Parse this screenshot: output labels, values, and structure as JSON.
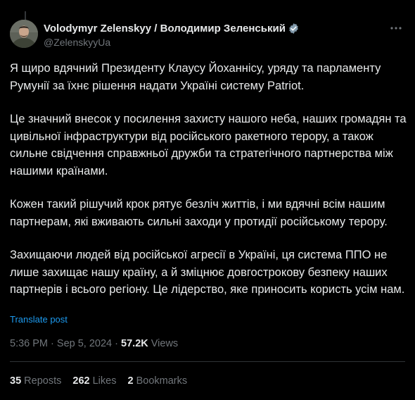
{
  "author": {
    "display_name": "Volodymyr Zelenskyy / Володимир Зеленський",
    "handle": "@ZelenskyyUa",
    "verified_icon": "verified-badge-icon",
    "avatar_icon": "avatar"
  },
  "more_icon": "more-options-icon",
  "post": {
    "paragraphs": [
      "Я щиро вдячний Президенту Клаусу Йоханнісу, уряду та парламенту Румунії за їхнє рішення надати Україні систему Patriot.",
      "Це значний внесок у посилення захисту нашого неба, наших громадян та цивільної інфраструктури від російського ракетного терору, а також сильне свідчення справжньої дружби та стратегічного партнерства між нашими країнами.",
      "Кожен такий рішучий крок рятує безліч життів, і ми вдячні всім нашим партнерам, які вживають сильні заходи у протидії російському терору.",
      "Захищаючи людей від російської агресії в Україні, ця система ППО не лише захищає нашу країну, а й зміцнює довгострокову безпеку наших партнерів і всього регіону. Це лідерство, яке приносить користь усім нам."
    ],
    "translate_label": "Translate post"
  },
  "meta": {
    "time": "5:36 PM",
    "separator": "·",
    "date": "Sep 5, 2024",
    "views_count": "57.2K",
    "views_label": "Views"
  },
  "stats": {
    "reposts_count": "35",
    "reposts_label": "Reposts",
    "likes_count": "262",
    "likes_label": "Likes",
    "bookmarks_count": "2",
    "bookmarks_label": "Bookmarks"
  },
  "colors": {
    "background": "#000000",
    "text": "#e7e9ea",
    "muted": "#71767b",
    "link": "#1d9bf0",
    "divider": "#2f3336"
  }
}
